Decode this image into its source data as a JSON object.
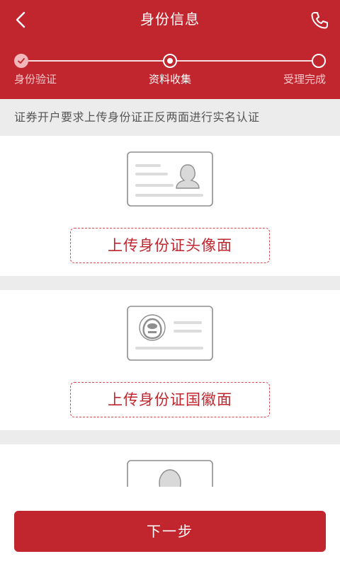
{
  "header": {
    "title": "身份信息",
    "back_icon": "chevron-left-icon",
    "phone_icon": "phone-icon"
  },
  "steps": [
    {
      "label": "身份验证",
      "state": "done"
    },
    {
      "label": "资料收集",
      "state": "active"
    },
    {
      "label": "受理完成",
      "state": "todo"
    }
  ],
  "notice": "证券开户要求上传身份证正反两面进行实名认证",
  "uploads": [
    {
      "label": "上传身份证头像面",
      "icon": "id-card-portrait-icon"
    },
    {
      "label": "上传身份证国徽面",
      "icon": "id-card-emblem-icon"
    },
    {
      "icon": "id-card-photo-icon"
    }
  ],
  "footer": {
    "next_label": "下一步"
  },
  "colors": {
    "primary": "#c1262f",
    "background": "#ececec",
    "dashed_border": "#d64a52"
  }
}
